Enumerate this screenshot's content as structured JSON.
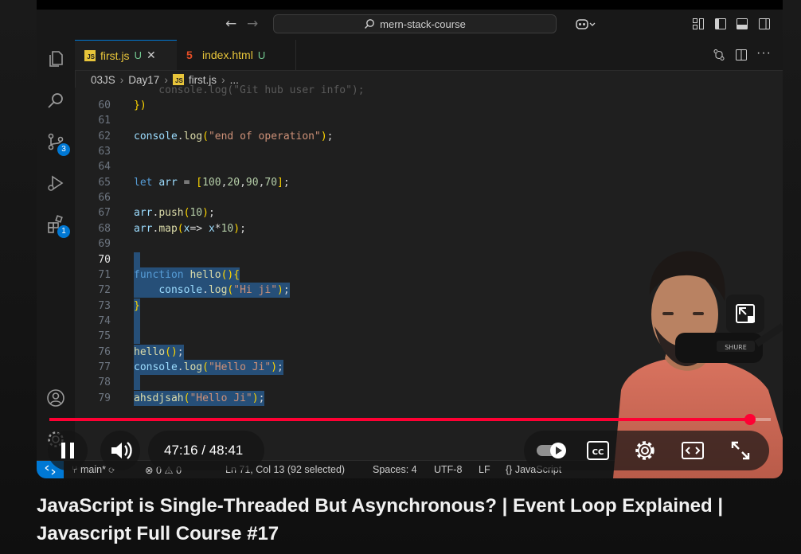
{
  "vscode": {
    "search_text": "mern-stack-course",
    "tabs": [
      {
        "label": "first.js",
        "status": "U",
        "active": true
      },
      {
        "label": "index.html",
        "status": "U",
        "active": false
      }
    ],
    "breadcrumb": [
      "03JS",
      "Day17",
      "first.js",
      "..."
    ],
    "badges": {
      "source_control": "3",
      "extensions": "1"
    },
    "code_lines": [
      {
        "num": "60",
        "text": "})"
      },
      {
        "num": "61",
        "text": ""
      },
      {
        "num": "62",
        "text": "console.log(\"end of operation\");"
      },
      {
        "num": "63",
        "text": ""
      },
      {
        "num": "64",
        "text": ""
      },
      {
        "num": "65",
        "text": "let arr = [100,20,90,70];"
      },
      {
        "num": "66",
        "text": ""
      },
      {
        "num": "67",
        "text": "arr.push(10);"
      },
      {
        "num": "68",
        "text": "arr.map(x=> x*10);"
      },
      {
        "num": "69",
        "text": ""
      },
      {
        "num": "70",
        "text": ""
      },
      {
        "num": "71",
        "text": "function hello(){"
      },
      {
        "num": "72",
        "text": "    console.log(\"Hi ji\");"
      },
      {
        "num": "73",
        "text": "}"
      },
      {
        "num": "74",
        "text": ""
      },
      {
        "num": "75",
        "text": ""
      },
      {
        "num": "76",
        "text": "hello();"
      },
      {
        "num": "77",
        "text": "console.log(\"Hello Ji\");"
      },
      {
        "num": "78",
        "text": ""
      },
      {
        "num": "79",
        "text": "ahsdjsah(\"Hello Ji\");"
      }
    ],
    "statusbar": {
      "branch": "main*",
      "errors": "0",
      "warnings": "0",
      "position": "Ln 71, Col 13 (92 selected)",
      "spaces": "Spaces: 4",
      "encoding": "UTF-8",
      "eol": "LF",
      "language": "JavaScript"
    }
  },
  "player": {
    "current_time": "47:16",
    "duration": "48:41",
    "progress": 0.971,
    "cc_label": "CC",
    "mic_label": "SHURE"
  },
  "video": {
    "title": "JavaScript is Single-Threaded But Asynchronous? | Event Loop Explained | Javascript Full Course #17"
  },
  "colors": {
    "progress": "#ff0033",
    "vscode_accent": "#0078d4",
    "selection": "#264f78"
  }
}
